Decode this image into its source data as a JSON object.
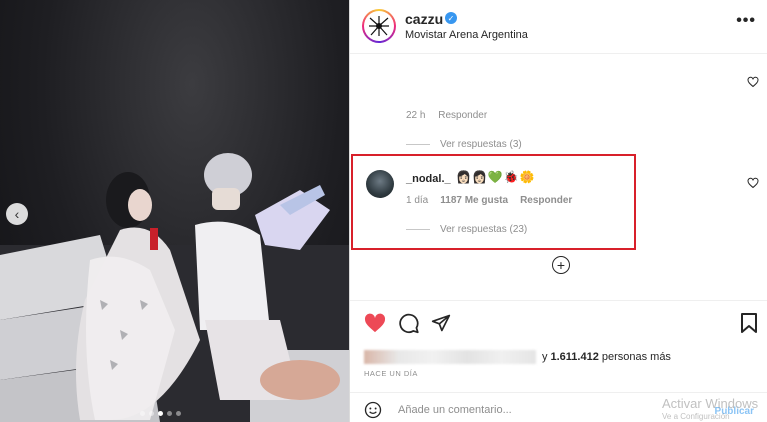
{
  "post": {
    "username": "cazzu",
    "location": "Movistar Arena Argentina",
    "more_label": "•••"
  },
  "partial_comment": {
    "time": "22 h",
    "reply_label": "Responder",
    "view_replies": "Ver respuestas (3)"
  },
  "highlighted_comment": {
    "username": "_nodal._",
    "emojis": "👩🏻👩🏻💚🐞🌼",
    "time": "1 día",
    "likes": "1187 Me gusta",
    "reply_label": "Responder",
    "view_replies": "Ver respuestas (23)"
  },
  "add_more_label": "+",
  "likes_line": {
    "prefix": "y",
    "count": "1.611.412",
    "suffix": "personas más"
  },
  "time_ago": "HACE UN DÍA",
  "comment_box": {
    "placeholder": "Añade un comentario...",
    "publish": "Publicar"
  },
  "watermark": {
    "line1": "Activar Windows",
    "line2": "Ve a Configuración"
  },
  "colors": {
    "like_red": "#ed4956",
    "verified_blue": "#3897f0",
    "highlight_red": "#d8202a",
    "publish_blue": "#8bc4f5"
  },
  "icons": [
    "arrow-left-icon",
    "more-icon",
    "heart-icon",
    "comment-icon",
    "share-icon",
    "bookmark-icon",
    "smile-icon",
    "add-icon",
    "verified-icon"
  ]
}
